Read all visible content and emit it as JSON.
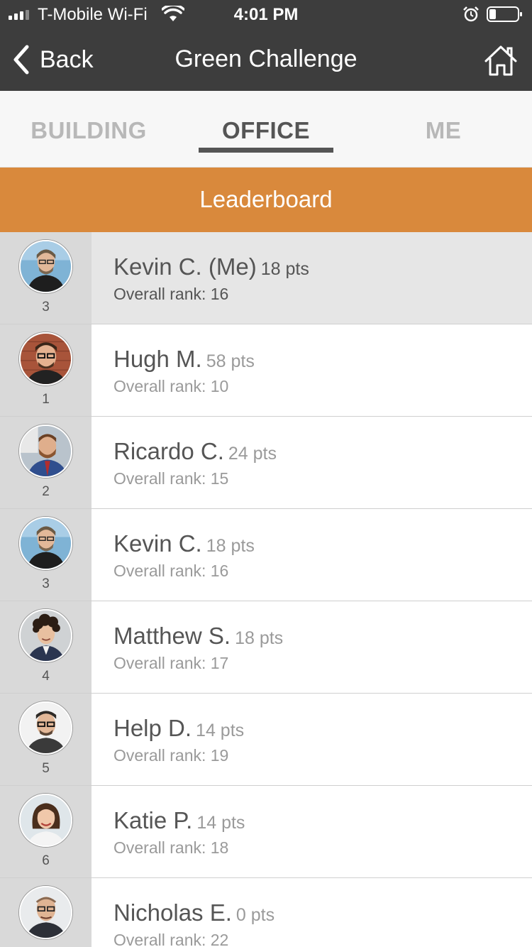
{
  "status_bar": {
    "carrier": "T-Mobile Wi-Fi",
    "time": "4:01 PM"
  },
  "nav": {
    "back_label": "Back",
    "title": "Green Challenge"
  },
  "tabs": [
    {
      "label": "BUILDING",
      "active": false
    },
    {
      "label": "OFFICE",
      "active": true
    },
    {
      "label": "ME",
      "active": false
    }
  ],
  "banner": {
    "label": "Leaderboard"
  },
  "colors": {
    "header_bg": "#3d3d3d",
    "banner_bg": "#d9893c",
    "rank_col_bg": "#d9d9d9",
    "me_row_bg": "#e6e6e6"
  },
  "leaderboard": [
    {
      "name": "Kevin C. (Me)",
      "pts": "18 pts",
      "overall": "Overall rank: 16",
      "rank": "3",
      "avatar_icon": "avatar-man-glasses-beard-icon",
      "is_me": true
    },
    {
      "name": "Hugh M.",
      "pts": "58 pts",
      "overall": "Overall rank: 10",
      "rank": "1",
      "avatar_icon": "avatar-man-glasses-brick-icon",
      "is_me": false
    },
    {
      "name": "Ricardo C.",
      "pts": "24 pts",
      "overall": "Overall rank: 15",
      "rank": "2",
      "avatar_icon": "avatar-man-beard-suit-icon",
      "is_me": false
    },
    {
      "name": "Kevin C.",
      "pts": "18 pts",
      "overall": "Overall rank: 16",
      "rank": "3",
      "avatar_icon": "avatar-man-glasses-beard-icon",
      "is_me": false
    },
    {
      "name": "Matthew S.",
      "pts": "18 pts",
      "overall": "Overall rank: 17",
      "rank": "4",
      "avatar_icon": "avatar-man-curly-hair-icon",
      "is_me": false
    },
    {
      "name": "Help D.",
      "pts": "14 pts",
      "overall": "Overall rank: 19",
      "rank": "5",
      "avatar_icon": "avatar-man-glasses-icon",
      "is_me": false
    },
    {
      "name": "Katie P.",
      "pts": "14 pts",
      "overall": "Overall rank: 18",
      "rank": "6",
      "avatar_icon": "avatar-woman-icon",
      "is_me": false
    },
    {
      "name": "Nicholas E.",
      "pts": "0 pts",
      "overall": "Overall rank: 22",
      "rank": "",
      "avatar_icon": "avatar-man-bald-glasses-icon",
      "is_me": false
    }
  ]
}
